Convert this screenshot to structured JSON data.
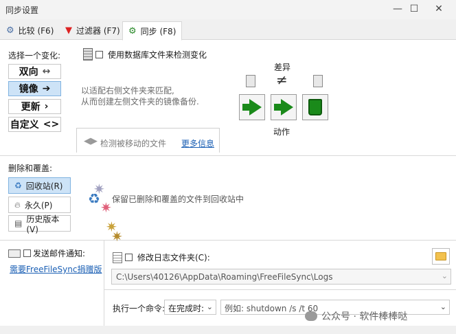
{
  "window": {
    "title": "同步设置",
    "minimize": "—",
    "maximize": "☐",
    "close": "✕"
  },
  "tabs": [
    {
      "label": "比较 (F6)",
      "icon": "gear-icon"
    },
    {
      "label": "过滤器 (F7)",
      "icon": "filter-icon"
    },
    {
      "label": "同步 (F8)",
      "icon": "gear-icon"
    }
  ],
  "variant": {
    "heading": "选择一个变化:",
    "items": [
      {
        "label": "双向",
        "symbol": "↔"
      },
      {
        "label": "镜像",
        "symbol": "➔"
      },
      {
        "label": "更新",
        "symbol": "›"
      },
      {
        "label": "自定义",
        "symbol": "<>"
      }
    ],
    "selected": "镜像"
  },
  "database_option": {
    "label": "使用数据库文件来检测变化",
    "checked": false
  },
  "mirror_desc": {
    "line1": "以适配右侧文件夹来匹配,",
    "line2": "从而创建左侧文件夹的镜像备份."
  },
  "detect_moved": {
    "label": "检测被移动的文件",
    "link": "更多信息"
  },
  "differences": {
    "label": "差异",
    "symbol": "≠"
  },
  "actions": {
    "label": "动作"
  },
  "deletion": {
    "heading": "删除和覆盖:",
    "items": [
      {
        "label": "回收站(R)",
        "icon": "recycle-icon"
      },
      {
        "label": "永久(P)",
        "icon": "fire-icon"
      },
      {
        "label": "历史版本(V)",
        "icon": "versioning-icon"
      }
    ],
    "selected": "回收站(R)",
    "desc": "保留已删除和覆盖的文件到回收站中"
  },
  "email": {
    "label": "发送邮件通知:",
    "checked": false,
    "link": "需要FreeFileSync捐赠版"
  },
  "log": {
    "label": "修改日志文件夹(C):",
    "checked": false,
    "path": "C:\\Users\\40126\\AppData\\Roaming\\FreeFileSync\\Logs"
  },
  "command": {
    "label": "执行一个命令:",
    "when": "在完成时:",
    "placeholder": "例如: shutdown /s /t 60"
  },
  "watermark": {
    "text": "公众号 · 软件棒棒哒"
  },
  "colors": {
    "selected_bg": "#cde3f7",
    "arrow_green": "#1a8a1a",
    "link_blue": "#1a5fb4"
  }
}
